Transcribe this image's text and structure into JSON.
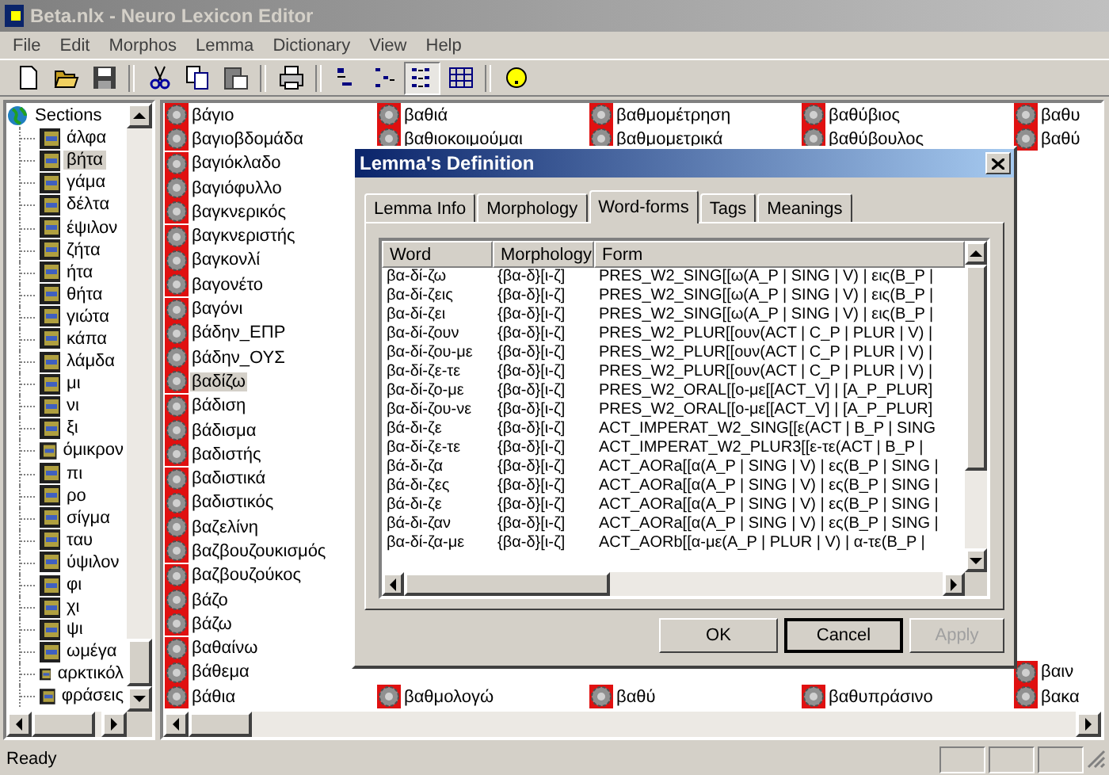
{
  "window": {
    "title": "Beta.nlx - Neuro Lexicon Editor"
  },
  "menu": [
    "File",
    "Edit",
    "Morphos",
    "Lemma",
    "Dictionary",
    "View",
    "Help"
  ],
  "toolbar": [
    {
      "kind": "new",
      "selected": false
    },
    {
      "kind": "open",
      "selected": false
    },
    {
      "kind": "save",
      "selected": false
    },
    {
      "kind": "separator"
    },
    {
      "kind": "cut",
      "selected": false
    },
    {
      "kind": "copy",
      "selected": false
    },
    {
      "kind": "paste",
      "selected": false
    },
    {
      "kind": "separator"
    },
    {
      "kind": "print",
      "selected": false
    },
    {
      "kind": "separator"
    },
    {
      "kind": "largeicons",
      "selected": false
    },
    {
      "kind": "smallicons",
      "selected": false
    },
    {
      "kind": "list",
      "selected": true
    },
    {
      "kind": "details",
      "selected": false
    },
    {
      "kind": "separator"
    },
    {
      "kind": "help",
      "selected": false
    }
  ],
  "sections": {
    "label": "Sections",
    "children": [
      {
        "label": "άλφα",
        "selected": false
      },
      {
        "label": "βήτα",
        "selected": true
      },
      {
        "label": "γάμα",
        "selected": false
      },
      {
        "label": "δέλτα",
        "selected": false
      },
      {
        "label": "έψιλον",
        "selected": false
      },
      {
        "label": "ζήτα",
        "selected": false
      },
      {
        "label": "ήτα",
        "selected": false
      },
      {
        "label": "θήτα",
        "selected": false
      },
      {
        "label": "γιώτα",
        "selected": false
      },
      {
        "label": "κάπα",
        "selected": false
      },
      {
        "label": "λάμδα",
        "selected": false
      },
      {
        "label": "μι",
        "selected": false
      },
      {
        "label": "νι",
        "selected": false
      },
      {
        "label": "ξι",
        "selected": false
      },
      {
        "label": "όμικρον",
        "selected": false
      },
      {
        "label": "πι",
        "selected": false
      },
      {
        "label": "ρο",
        "selected": false
      },
      {
        "label": "σίγμα",
        "selected": false
      },
      {
        "label": "ταυ",
        "selected": false
      },
      {
        "label": "ύψιλον",
        "selected": false
      },
      {
        "label": "φι",
        "selected": false
      },
      {
        "label": "χι",
        "selected": false
      },
      {
        "label": "ψι",
        "selected": false
      },
      {
        "label": "ωμέγα",
        "selected": false
      },
      {
        "label": "αρκτικόλ",
        "selected": false
      },
      {
        "label": "φράσεις",
        "selected": false
      }
    ]
  },
  "lemmas": {
    "columns": [
      {
        "top": [
          {
            "label": "βάγιο",
            "selected": false
          },
          {
            "label": "βαγιοβδομάδα",
            "selected": false
          },
          {
            "label": "βαγιόκλαδο",
            "selected": false
          },
          {
            "label": "βαγιόφυλλο",
            "selected": false
          },
          {
            "label": "βαγκνερικός",
            "selected": false
          },
          {
            "label": "βαγκνεριστής",
            "selected": false
          },
          {
            "label": "βαγκονλί",
            "selected": false
          },
          {
            "label": "βαγονέτο",
            "selected": false
          },
          {
            "label": "βαγόνι",
            "selected": false
          },
          {
            "label": "βάδην_ΕΠΡ",
            "selected": false
          },
          {
            "label": "βάδην_ΟΥΣ",
            "selected": false
          },
          {
            "label": "βαδίζω",
            "selected": true
          },
          {
            "label": "βάδιση",
            "selected": false
          },
          {
            "label": "βάδισμα",
            "selected": false
          },
          {
            "label": "βαδιστής",
            "selected": false
          },
          {
            "label": "βαδιστικά",
            "selected": false
          },
          {
            "label": "βαδιστικός",
            "selected": false
          },
          {
            "label": "βαζελίνη",
            "selected": false
          },
          {
            "label": "βαζβουζουκισμός",
            "selected": false
          },
          {
            "label": "βαζβουζούκος",
            "selected": false
          },
          {
            "label": "βάζο",
            "selected": false
          },
          {
            "label": "βάζω",
            "selected": false
          },
          {
            "label": "βαθαίνω",
            "selected": false
          },
          {
            "label": "βάθεμα",
            "selected": false
          },
          {
            "label": "βάθια",
            "selected": false
          }
        ]
      },
      {
        "top": [
          {
            "label": "βαθιά",
            "selected": false
          },
          {
            "label": "βαθιοκοιμούμαι",
            "selected": false
          }
        ],
        "bottom": [
          {
            "label": "βαθμολογώ",
            "selected": false
          }
        ]
      },
      {
        "top": [
          {
            "label": "βαθμομέτρηση",
            "selected": false
          },
          {
            "label": "βαθμομετρικά",
            "selected": false
          }
        ],
        "bottom": [
          {
            "label": "βαθύ",
            "selected": false
          }
        ]
      },
      {
        "top": [
          {
            "label": "βαθύβιος",
            "selected": false
          },
          {
            "label": "βαθύβουλος",
            "selected": false
          }
        ],
        "bottom": [
          {
            "label": "βαθυπράσινο",
            "selected": false
          }
        ]
      },
      {
        "top": [
          {
            "label": "βαθυ",
            "selected": false
          },
          {
            "label": "βαθύ",
            "selected": false
          }
        ],
        "bottom": [
          {
            "label": "βαιν",
            "selected": false
          },
          {
            "label": "βακα",
            "selected": false
          }
        ]
      }
    ]
  },
  "dialog": {
    "title": "Lemma's Definition",
    "tabs": [
      {
        "label": "Lemma Info",
        "selected": false
      },
      {
        "label": "Morphology",
        "selected": false
      },
      {
        "label": "Word-forms",
        "selected": true
      },
      {
        "label": "Tags",
        "selected": false
      },
      {
        "label": "Meanings",
        "selected": false
      }
    ],
    "table": {
      "columns": [
        "Word",
        "Morphology",
        "Form"
      ],
      "rows": [
        [
          "βα-δί-ζω",
          "{βα-δ}[ι-ζ]",
          "PRES_W2_SING[[ω(A_P | SING | V) | εις(B_P |"
        ],
        [
          "βα-δί-ζεις",
          "{βα-δ}[ι-ζ]",
          "PRES_W2_SING[[ω(A_P | SING | V) | εις(B_P |"
        ],
        [
          "βα-δί-ζει",
          "{βα-δ}[ι-ζ]",
          "PRES_W2_SING[[ω(A_P | SING | V) | εις(B_P |"
        ],
        [
          "βα-δί-ζουν",
          "{βα-δ}[ι-ζ]",
          "PRES_W2_PLUR[[ουν(ACT | C_P | PLUR | V) |"
        ],
        [
          "βα-δί-ζου-με",
          "{βα-δ}[ι-ζ]",
          "PRES_W2_PLUR[[ουν(ACT | C_P | PLUR | V) |"
        ],
        [
          "βα-δί-ζε-τε",
          "{βα-δ}[ι-ζ]",
          "PRES_W2_PLUR[[ουν(ACT | C_P | PLUR | V) |"
        ],
        [
          "βα-δί-ζο-με",
          "{βα-δ}[ι-ζ]",
          "PRES_W2_ORAL[[ο-με[[ACT_V] | [A_P_PLUR]"
        ],
        [
          "βα-δί-ζου-νε",
          "{βα-δ}[ι-ζ]",
          "PRES_W2_ORAL[[ο-με[[ACT_V] | [A_P_PLUR]"
        ],
        [
          "βά-δι-ζε",
          "{βα-δ}[ι-ζ]",
          "ACT_IMPERAT_W2_SING[[ε(ACT | B_P | SING"
        ],
        [
          "βα-δί-ζε-τε",
          "{βα-δ}[ι-ζ]",
          "ACT_IMPERAT_W2_PLUR3[[ε-τε(ACT | B_P |"
        ],
        [
          "βά-δι-ζα",
          "{βα-δ}[ι-ζ]",
          "ACT_AORa[[α(A_P | SING | V) | ες(B_P | SING |"
        ],
        [
          "βά-δι-ζες",
          "{βα-δ}[ι-ζ]",
          "ACT_AORa[[α(A_P | SING | V) | ες(B_P | SING |"
        ],
        [
          "βά-δι-ζε",
          "{βα-δ}[ι-ζ]",
          "ACT_AORa[[α(A_P | SING | V) | ες(B_P | SING |"
        ],
        [
          "βά-δι-ζαν",
          "{βα-δ}[ι-ζ]",
          "ACT_AORa[[α(A_P | SING | V) | ες(B_P | SING |"
        ],
        [
          "βα-δί-ζα-με",
          "{βα-δ}[ι-ζ]",
          "ACT_AORb[[α-με(A_P | PLUR | V) | α-τε(B_P |"
        ]
      ]
    },
    "buttons": [
      {
        "label": "OK",
        "kind": "normal",
        "disabled": false
      },
      {
        "label": "Cancel",
        "kind": "default",
        "disabled": false
      },
      {
        "label": "Apply",
        "kind": "normal",
        "disabled": true
      }
    ]
  },
  "status_bar": {
    "text": "Ready"
  }
}
